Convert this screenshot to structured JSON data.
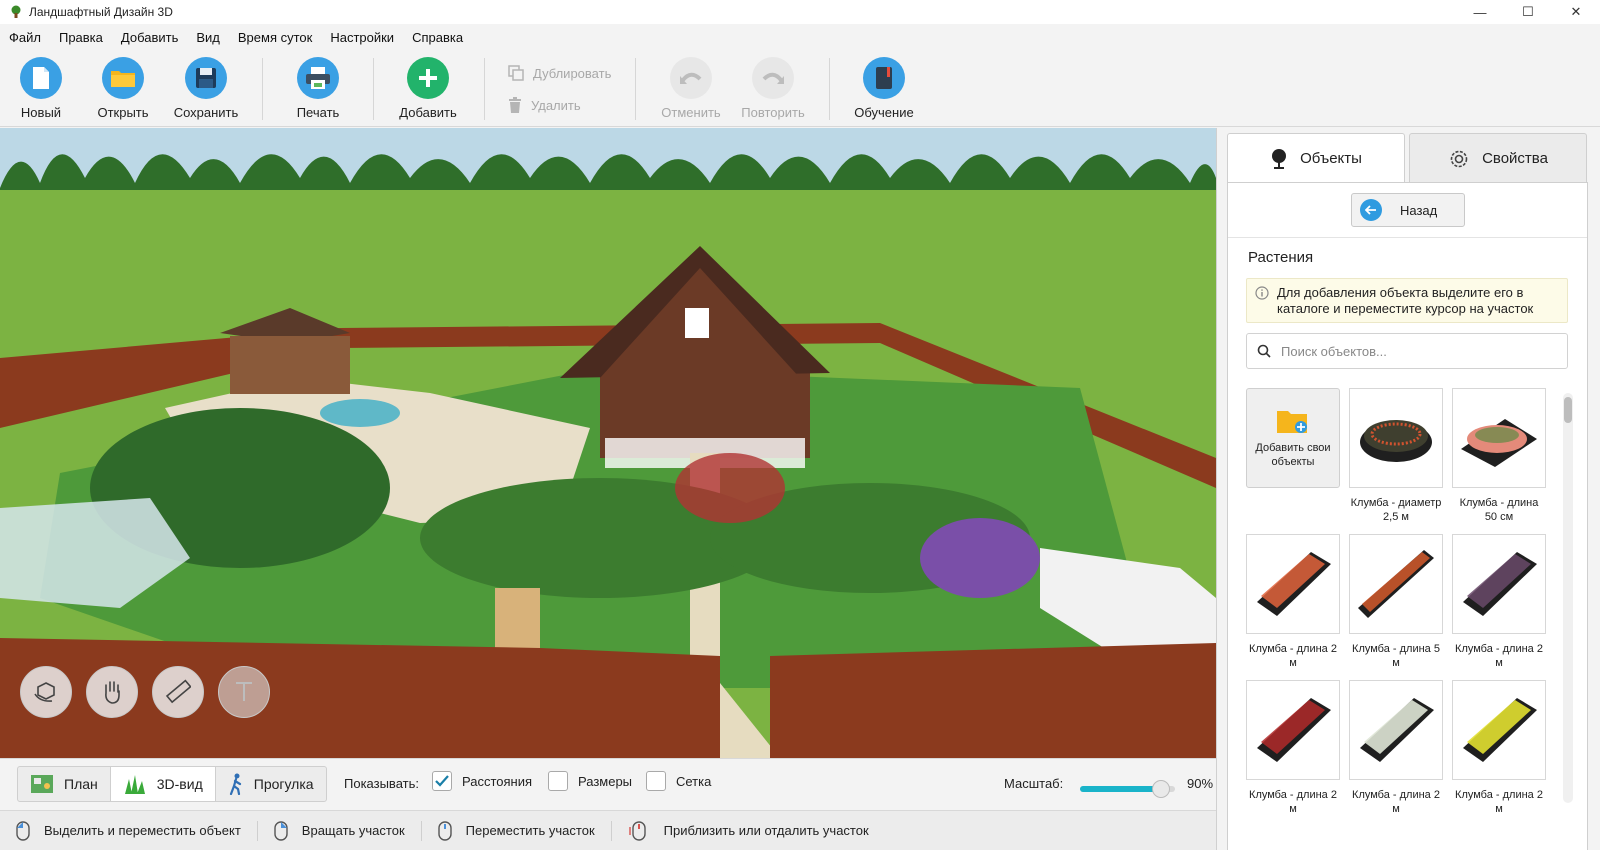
{
  "window": {
    "title": "Ландшафтный Дизайн 3D",
    "controls": [
      "—",
      "☐",
      "✕"
    ]
  },
  "menu": [
    "Файл",
    "Правка",
    "Добавить",
    "Вид",
    "Время суток",
    "Настройки",
    "Справка"
  ],
  "toolbar": {
    "new": "Новый",
    "open": "Открыть",
    "save": "Сохранить",
    "print": "Печать",
    "add": "Добавить",
    "duplicate": "Дублировать",
    "delete": "Удалить",
    "undo": "Отменить",
    "redo": "Повторить",
    "tutorial": "Обучение"
  },
  "colors": {
    "accent": "#2f9be0",
    "slider": "#19b3c9",
    "grass": "#7cb342",
    "fence": "#8b3a1e",
    "house": "#6b3a26"
  },
  "view_tools": [
    "rotate-3d-icon",
    "hand-icon",
    "ruler-icon",
    "text-icon"
  ],
  "view_tabs": {
    "plan": "План",
    "view3d": "3D-вид",
    "walk": "Прогулка"
  },
  "show": {
    "label": "Показывать:",
    "distances": {
      "label": "Расстояния",
      "checked": true
    },
    "sizes": {
      "label": "Размеры",
      "checked": false
    },
    "grid": {
      "label": "Сетка",
      "checked": false
    }
  },
  "scale": {
    "label": "Масштаб:",
    "value": "90%",
    "fraction": 0.85
  },
  "status": [
    "Выделить и переместить объект",
    "Вращать участок",
    "Переместить участок",
    "Приблизить или отдалить участок"
  ],
  "panel": {
    "tabs": {
      "objects": "Объекты",
      "properties": "Свойства"
    },
    "back": "Назад",
    "section": "Растения",
    "hint": "Для добавления объекта выделите его в каталоге и переместите курсор на участок",
    "search_placeholder": "Поиск объектов...",
    "add_own": "Добавить свои объекты",
    "items": [
      "Клумба - диаметр 2,5 м",
      "Клумба - длина 50 см",
      "Клумба - длина 2 м",
      "Клумба - длина 5 м",
      "Клумба - длина 2 м",
      "Клумба - длина 2 м",
      "Клумба - длина 2 м",
      "Клумба - длина 2 м"
    ]
  }
}
